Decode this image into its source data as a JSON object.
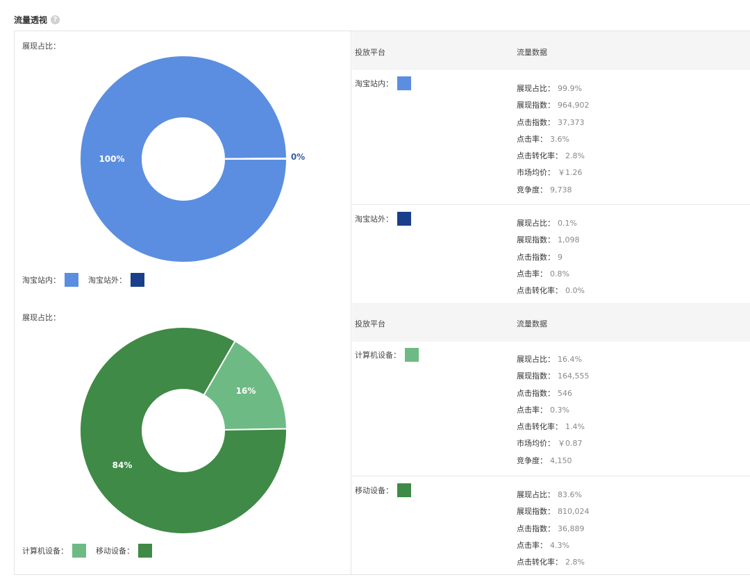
{
  "page": {
    "title": "流量透视"
  },
  "colors": {
    "site_in": "#5b8ee0",
    "site_out": "#1a3f8a",
    "pc": "#6eba84",
    "mobile": "#3f8a46"
  },
  "table_header": {
    "platform": "投放平台",
    "data": "流量数据"
  },
  "chart_data": [
    {
      "type": "pie",
      "label": "展现占比：",
      "slices": [
        {
          "name": "淘宝站内",
          "value": 99.9,
          "display": "100%",
          "color": "#5b8ee0"
        },
        {
          "name": "淘宝站外",
          "value": 0.1,
          "display": "0%",
          "color": "#1a3f8a"
        }
      ],
      "legend": [
        {
          "label": "淘宝站内：",
          "color": "#5b8ee0"
        },
        {
          "label": "淘宝站外：",
          "color": "#1a3f8a"
        }
      ],
      "legend_position": "bottom-left"
    },
    {
      "type": "pie",
      "label": "展现占比：",
      "slices": [
        {
          "name": "计算机设备",
          "value": 16.4,
          "display": "16%",
          "color": "#6eba84"
        },
        {
          "name": "移动设备",
          "value": 83.6,
          "display": "84%",
          "color": "#3f8a46"
        }
      ],
      "legend": [
        {
          "label": "计算机设备：",
          "color": "#6eba84"
        },
        {
          "label": "移动设备：",
          "color": "#3f8a46"
        }
      ],
      "legend_position": "bottom-left"
    }
  ],
  "tables": [
    {
      "rows": [
        {
          "platform": "淘宝站内：",
          "color": "#5b8ee0",
          "metrics": [
            {
              "key": "展现占比：",
              "value": "99.9%"
            },
            {
              "key": "展现指数：",
              "value": "964,902"
            },
            {
              "key": "点击指数：",
              "value": "37,373"
            },
            {
              "key": "点击率：",
              "value": "3.6%"
            },
            {
              "key": "点击转化率：",
              "value": "2.8%"
            },
            {
              "key": "市场均价：",
              "value": "￥1.26"
            },
            {
              "key": "竞争度：",
              "value": "9,738"
            }
          ]
        },
        {
          "platform": "淘宝站外：",
          "color": "#1a3f8a",
          "metrics": [
            {
              "key": "展现占比：",
              "value": "0.1%"
            },
            {
              "key": "展现指数：",
              "value": "1,098"
            },
            {
              "key": "点击指数：",
              "value": "9"
            },
            {
              "key": "点击率：",
              "value": "0.8%"
            },
            {
              "key": "点击转化率：",
              "value": "0.0%"
            }
          ]
        }
      ]
    },
    {
      "rows": [
        {
          "platform": "计算机设备：",
          "color": "#6eba84",
          "metrics": [
            {
              "key": "展现占比：",
              "value": "16.4%"
            },
            {
              "key": "展现指数：",
              "value": "164,555"
            },
            {
              "key": "点击指数：",
              "value": "546"
            },
            {
              "key": "点击率：",
              "value": "0.3%"
            },
            {
              "key": "点击转化率：",
              "value": "1.4%"
            },
            {
              "key": "市场均价：",
              "value": "￥0.87"
            },
            {
              "key": "竞争度：",
              "value": "4,150"
            }
          ]
        },
        {
          "platform": "移动设备：",
          "color": "#3f8a46",
          "metrics": [
            {
              "key": "展现占比：",
              "value": "83.6%"
            },
            {
              "key": "展现指数：",
              "value": "810,024"
            },
            {
              "key": "点击指数：",
              "value": "36,889"
            },
            {
              "key": "点击率：",
              "value": "4.3%"
            },
            {
              "key": "点击转化率：",
              "value": "2.8%"
            }
          ]
        }
      ]
    }
  ]
}
